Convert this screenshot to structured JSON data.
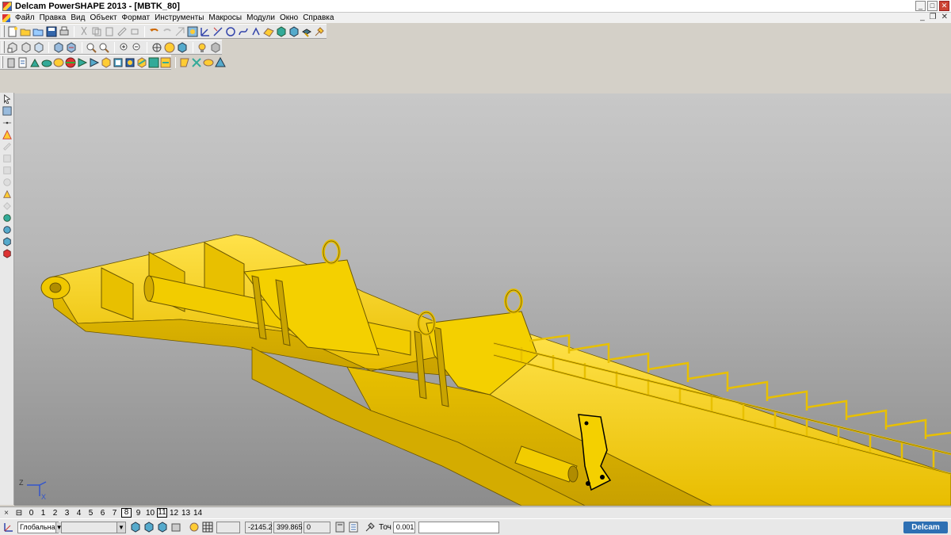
{
  "window": {
    "title": "Delcam PowerSHAPE 2013 - [MBTK_80]",
    "minimize_label": "_",
    "maximize_label": "□",
    "close_label": "✕"
  },
  "menu": {
    "items": [
      "Файл",
      "Правка",
      "Вид",
      "Объект",
      "Формат",
      "Инструменты",
      "Макросы",
      "Модули",
      "Окно",
      "Справка"
    ],
    "mdi_minimize": "_",
    "mdi_restore": "❐",
    "mdi_close": "✕"
  },
  "levels": {
    "numbers": [
      "0",
      "1",
      "2",
      "3",
      "4",
      "5",
      "6",
      "7",
      "8",
      "9",
      "10",
      "11",
      "12",
      "13",
      "14"
    ],
    "boxed": [
      "8",
      "11"
    ]
  },
  "status": {
    "workplane": "Глобальна",
    "x": "-2145.2",
    "y": "399.865",
    "z": "0",
    "tolerance_label": "Точ",
    "tolerance_value": "0.001"
  },
  "axis": {
    "z_label": "Z",
    "x_label": "X"
  },
  "brand": {
    "label": "Delcam"
  },
  "colors": {
    "model": "#f2cc00",
    "model_dark": "#c9a400",
    "model_edge": "#6b5600",
    "viewport_top": "#c8c8c8",
    "viewport_bottom": "#8c8c8c"
  }
}
